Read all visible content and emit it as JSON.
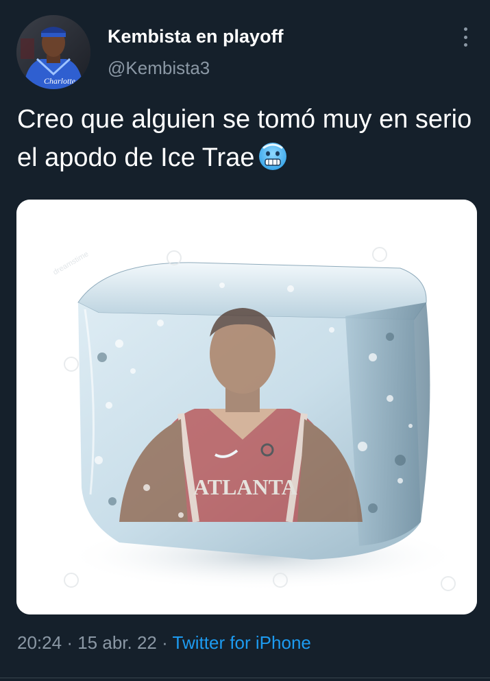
{
  "tweet": {
    "author_name": "Kembista en playoff",
    "author_handle": "@Kembista3",
    "text": "Creo que alguien se tomó muy en serio el apodo de Ice Trae",
    "emoji": "cold-face-emoji",
    "time": "20:24",
    "separator": "·",
    "date": "15 abr. 22",
    "source": "Twitter for iPhone"
  },
  "media": {
    "jersey_text": "ATLANTA",
    "watermark": "dreamstime"
  },
  "avatar": {
    "jersey_text": "Charlotte"
  },
  "colors": {
    "background": "#15202b",
    "secondary_text": "#8b98a5",
    "link": "#1d9bf0"
  }
}
